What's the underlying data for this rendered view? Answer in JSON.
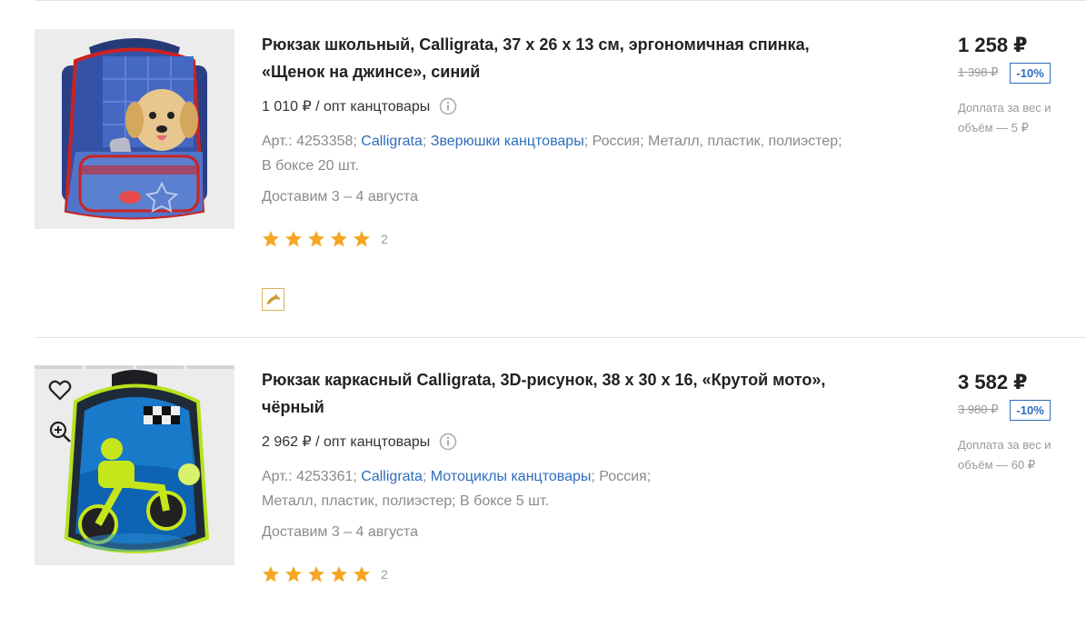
{
  "products": [
    {
      "title": "Рюкзак школьный, Calligrata, 37 х 26 х 13 см, эргономичная спинка, «Щенок на джинсе», синий",
      "opt_price": "1 010 ₽ / опт канцтовары",
      "article": "Арт.: 4253358;",
      "brand": "Calligrata",
      "category": "Зверюшки канцтовары",
      "country": "Россия;",
      "material": "Металл, пластик, полиэстер;",
      "box": "В боксе 20 шт.",
      "delivery": "Доставим 3 – 4 августа",
      "rating_count": "2",
      "price": "1 258 ₽",
      "old_price": "1 398 ₽",
      "discount": "-10%",
      "surcharge": "Доплата за вес и объём — 5 ₽"
    },
    {
      "title": "Рюкзак каркасный Calligrata, 3D-рисунок, 38 х 30 х 16, «Крутой мото», чёрный",
      "opt_price": "2 962 ₽ / опт канцтовары",
      "article": "Арт.: 4253361;",
      "brand": "Calligrata",
      "category": "Мотоциклы канцтовары",
      "country": "Россия;",
      "material": "Металл, пластик, полиэстер;",
      "box": "В боксе 5 шт.",
      "delivery": "Доставим 3 – 4 августа",
      "rating_count": "2",
      "price": "3 582 ₽",
      "old_price": "3 980 ₽",
      "discount": "-10%",
      "surcharge": "Доплата за вес и объём — 60 ₽"
    }
  ],
  "colors": {
    "link": "#2e6dbd",
    "star": "#f5a623",
    "muted": "#8a8a8a"
  },
  "icons": {
    "info": "info-icon",
    "star": "star-icon",
    "favorite": "heart-icon",
    "zoom": "zoom-in-icon",
    "badge": "dolphin-icon"
  }
}
